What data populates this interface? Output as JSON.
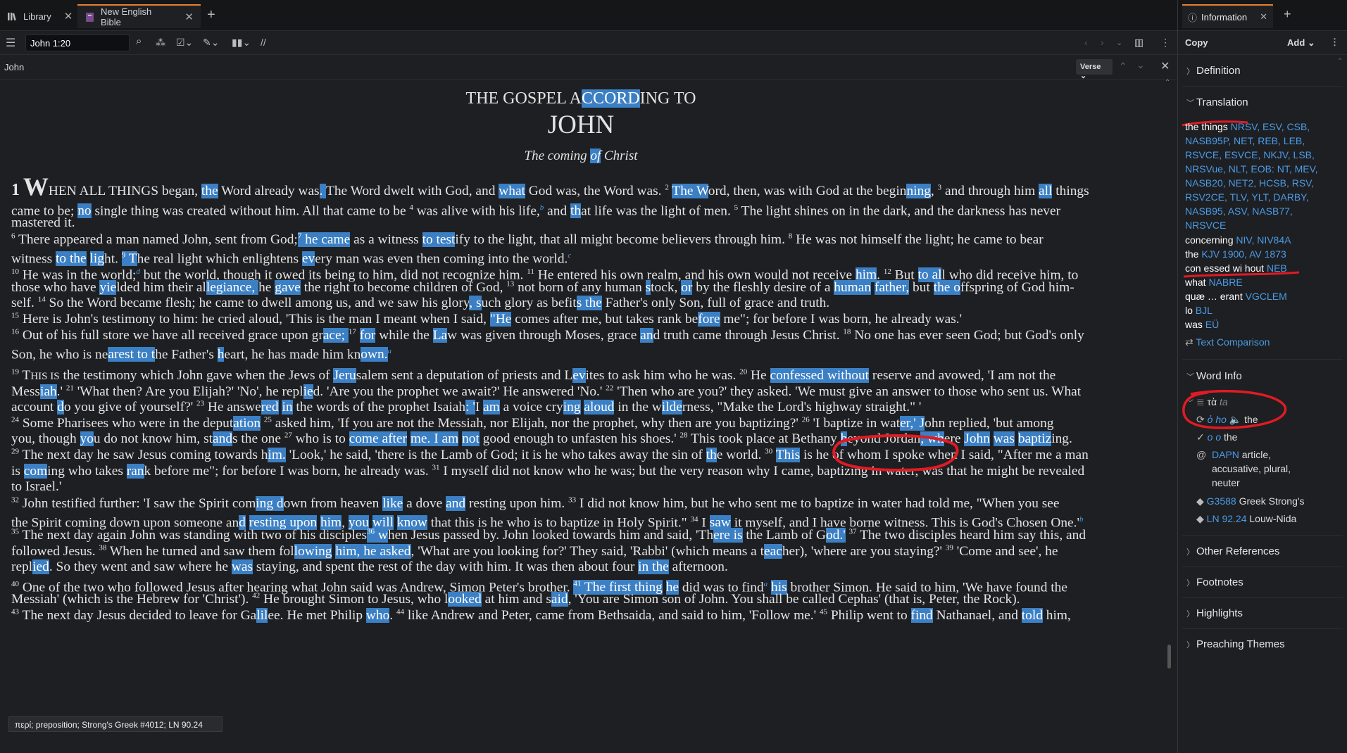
{
  "tabs": {
    "library": "Library",
    "bible": "New English Bible"
  },
  "toolbar": {
    "reference": "John 1:20"
  },
  "subheader": {
    "book": "John",
    "verse_mode": "Verse"
  },
  "bible": {
    "title_line1": "THE GOSPEL ACCORDING TO",
    "title_line2": "JOHN",
    "section": "The coming of Christ"
  },
  "tooltip": "περί; preposition; Strong's Greek #4012; LN 90.24",
  "panel": {
    "tab": "Information",
    "copy": "Copy",
    "add": "Add",
    "definition": "Definition",
    "translation": "Translation",
    "word_info": "Word Info",
    "other_references": "Other References",
    "footnotes": "Footnotes",
    "highlights": "Highlights",
    "preaching_themes": "Preaching Themes",
    "text_comparison": "Text Comparison",
    "wi": {
      "lemma_greek": "τὰ",
      "lemma_translit": "ta",
      "root_greek": "ὁ",
      "root_translit": "ho",
      "root_gloss": "the",
      "parse_greek": "ο",
      "parse_translit": "o",
      "parse_gloss": "the",
      "morph_code": "DAPN",
      "morph_desc1": "article,",
      "morph_desc2": "accusative, plural,",
      "morph_desc3": "neuter",
      "strongs_num": "G3588",
      "strongs_label": "Greek Strong's",
      "ln_num": "LN 92.24",
      "ln_label": "Louw-Nida"
    },
    "renderings": [
      {
        "text": "the things",
        "versions": "NRSV, ESV, CSB,"
      },
      {
        "text": "",
        "versions": "NASB95P, NET, REB, LEB,"
      },
      {
        "text": "",
        "versions": "RSVCE, ESVCE, NKJV, LSB,"
      },
      {
        "text": "",
        "versions": "NRSVue, NLT, EOB: NT, MEV,"
      },
      {
        "text": "",
        "versions": "NASB20, NET2, HCSB, RSV,"
      },
      {
        "text": "",
        "versions": "RSV2CE, TLV, YLT, DARBY,"
      },
      {
        "text": "",
        "versions": "NASB95, ASV, NASB77,"
      },
      {
        "text": "",
        "versions": "NRSVCE"
      },
      {
        "text": "concerning",
        "versions": "NIV, NIV84A"
      },
      {
        "text": "the",
        "versions": "KJV 1900, AV 1873"
      },
      {
        "text": "con essed wi hout",
        "versions": "NEB"
      },
      {
        "text": "what",
        "versions": "NABRE"
      },
      {
        "text": "quæ … erant",
        "versions": "VGCLEM"
      },
      {
        "text": "lo",
        "versions": "BJL"
      },
      {
        "text": "was",
        "versions": "EÜ"
      }
    ]
  }
}
